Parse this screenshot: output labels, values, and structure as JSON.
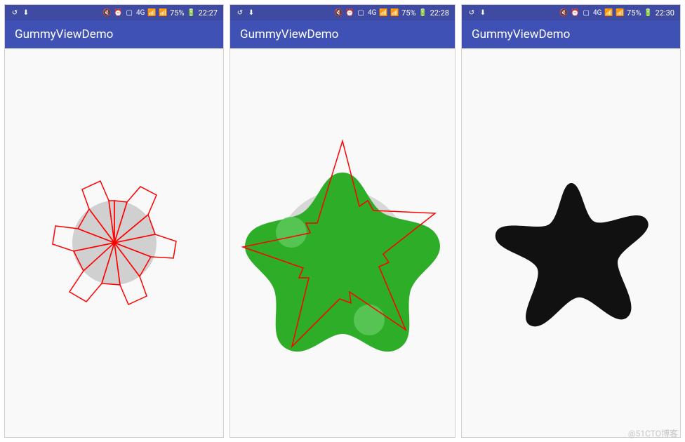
{
  "panels": [
    {
      "app_title": "GummyViewDemo",
      "status": {
        "battery_pct": "75%",
        "time": "22:27"
      }
    },
    {
      "app_title": "GummyViewDemo",
      "status": {
        "battery_pct": "75%",
        "time": "22:28"
      }
    },
    {
      "app_title": "GummyViewDemo",
      "status": {
        "battery_pct": "75%",
        "time": "22:30"
      }
    }
  ],
  "network_label": "4G",
  "watermark": "@51CTO博客",
  "colors": {
    "status_bg": "#3f4ba3",
    "appbar_bg": "#3f51b5",
    "circle_gray": "#d0d0d0",
    "stroke_red": "#ff0000",
    "green_fill": "#2dad28",
    "green_light": "#5dc85a",
    "black_shape": "#111111"
  },
  "chart_data": {
    "type": "other",
    "note": "Custom view demos: radial wedge paths over gray circle; green blob with red star outline; black starfish shape."
  }
}
